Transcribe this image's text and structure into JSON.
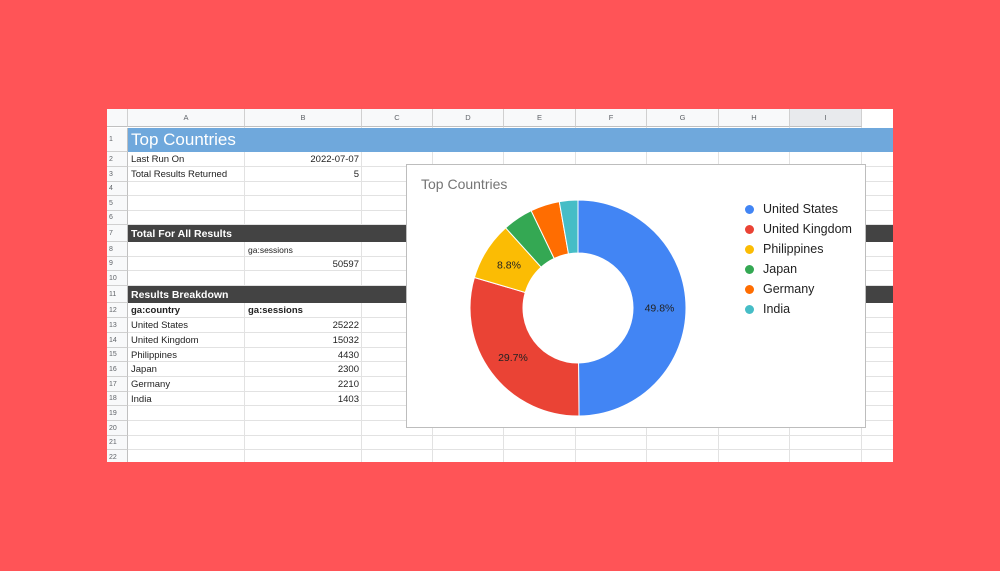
{
  "columns": [
    "A",
    "B",
    "C",
    "D",
    "E",
    "F",
    "G",
    "H",
    "I"
  ],
  "rows": [
    "1",
    "2",
    "3",
    "4",
    "5",
    "6",
    "7",
    "8",
    "9",
    "10",
    "11",
    "12",
    "13",
    "14",
    "15",
    "16",
    "17",
    "18",
    "19",
    "20",
    "21",
    "22"
  ],
  "sheet": {
    "title": "Top Countries",
    "last_run_label": "Last Run On",
    "last_run_value": "2022-07-07",
    "total_results_label": "Total Results Returned",
    "total_results_value": "5",
    "total_header": "Total For All Results",
    "total_metric_header": "ga:sessions",
    "total_metric_value": "50597",
    "breakdown_header": "Results Breakdown",
    "breakdown_col_country": "ga:country",
    "breakdown_col_sessions": "ga:sessions",
    "breakdown_rows": [
      {
        "country": "United States",
        "sessions": "25222"
      },
      {
        "country": "United Kingdom",
        "sessions": "15032"
      },
      {
        "country": "Philippines",
        "sessions": "4430"
      },
      {
        "country": "Japan",
        "sessions": "2300"
      },
      {
        "country": "Germany",
        "sessions": "2210"
      },
      {
        "country": "India",
        "sessions": "1403"
      }
    ]
  },
  "chart_data": {
    "type": "pie",
    "donut": true,
    "title": "Top Countries",
    "categories": [
      "United States",
      "United Kingdom",
      "Philippines",
      "Japan",
      "Germany",
      "India"
    ],
    "values": [
      25222,
      15032,
      4430,
      2300,
      2210,
      1403
    ],
    "colors": [
      "#4285f4",
      "#ea4335",
      "#fbbc04",
      "#34a853",
      "#ff6d01",
      "#46bdc6"
    ],
    "data_labels": [
      "49.8%",
      "29.7%",
      "8.8%",
      "",
      "",
      ""
    ],
    "legend_position": "right"
  }
}
